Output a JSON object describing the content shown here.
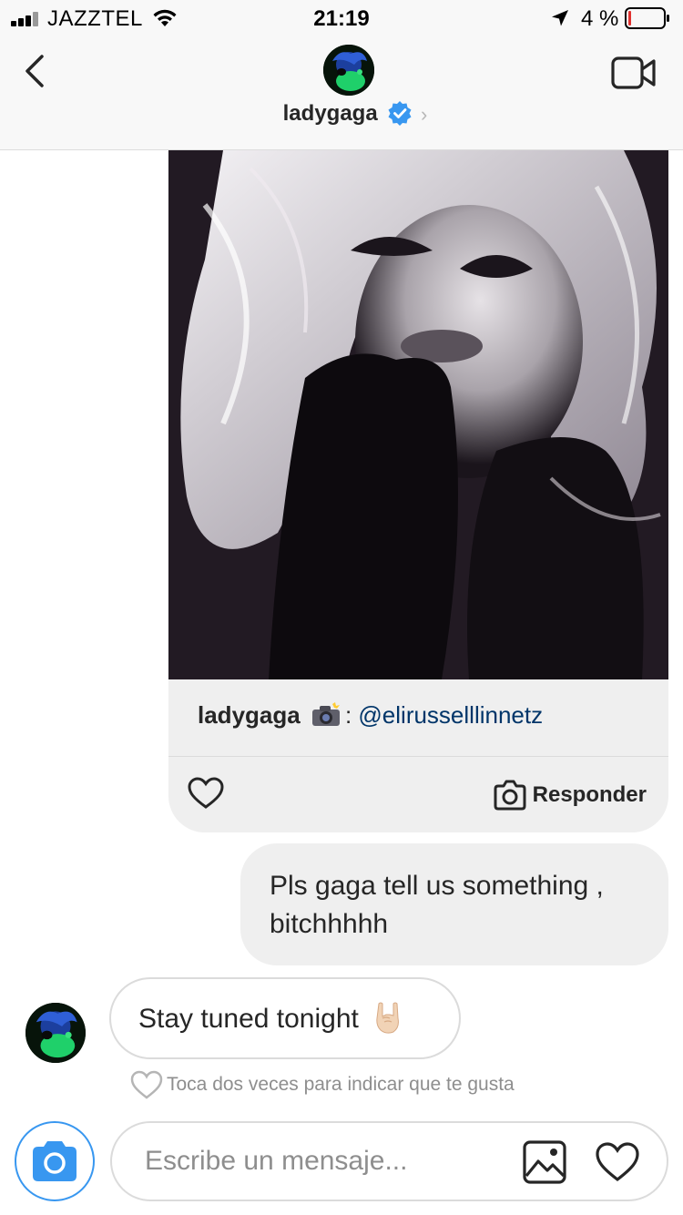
{
  "status_bar": {
    "carrier": "JAZZTEL",
    "time": "21:19",
    "battery": "4 %"
  },
  "header": {
    "username": "ladygaga",
    "verified": true,
    "chevron": "›",
    "icons": [
      "back-chevron-icon",
      "verified-badge-icon",
      "video-call-icon"
    ]
  },
  "shared_post": {
    "caption_user": "ladygaga",
    "caption_mention": "@elirusselllinnetz",
    "reply_label": "Responder",
    "photo_description_icon": "camera-flash-emoji"
  },
  "messages": [
    {
      "direction": "outgoing",
      "text": "Pls gaga tell us something , bitchhhhh"
    },
    {
      "direction": "incoming",
      "text": "Stay tuned tonight",
      "emoji": "sign-of-horns-emoji"
    }
  ],
  "like_hint": "Toca dos veces para indicar que te gusta",
  "composer": {
    "placeholder": "Escribe un mensaje..."
  },
  "colors": {
    "accent_blue": "#3897f0",
    "mention_blue": "#003569",
    "bubble_gray": "#efefef",
    "battery_low": "#e0312f"
  }
}
